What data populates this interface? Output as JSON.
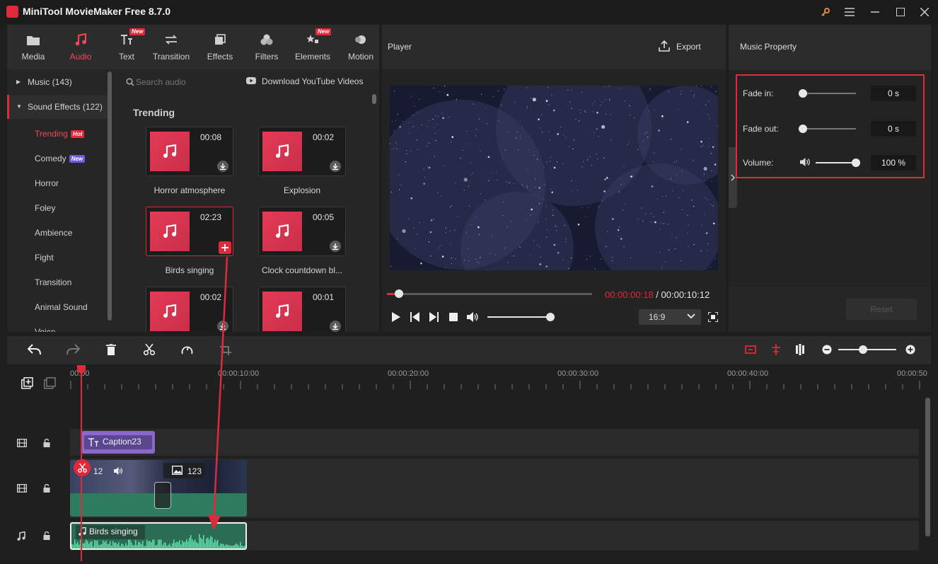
{
  "app": {
    "title": "MiniTool MovieMaker Free 8.7.0"
  },
  "tabs": [
    {
      "label": "Media",
      "icon": "folder-icon",
      "new": false
    },
    {
      "label": "Audio",
      "icon": "music-note-icon",
      "new": false
    },
    {
      "label": "Text",
      "icon": "text-icon",
      "new": true
    },
    {
      "label": "Transition",
      "icon": "transition-icon",
      "new": false
    },
    {
      "label": "Effects",
      "icon": "effects-icon",
      "new": false
    },
    {
      "label": "Filters",
      "icon": "filters-icon",
      "new": false
    },
    {
      "label": "Elements",
      "icon": "elements-icon",
      "new": true
    },
    {
      "label": "Motion",
      "icon": "motion-icon",
      "new": false
    }
  ],
  "new_badge": "New",
  "categories": {
    "music": "Music (143)",
    "sound_effects": "Sound Effects (122)",
    "sub": [
      {
        "label": "Trending",
        "badge": "Hot",
        "active": true
      },
      {
        "label": "Comedy",
        "badge": "New",
        "active": false
      },
      {
        "label": "Horror",
        "badge": "",
        "active": false
      },
      {
        "label": "Foley",
        "badge": "",
        "active": false
      },
      {
        "label": "Ambience",
        "badge": "",
        "active": false
      },
      {
        "label": "Fight",
        "badge": "",
        "active": false
      },
      {
        "label": "Transition",
        "badge": "",
        "active": false
      },
      {
        "label": "Animal Sound",
        "badge": "",
        "active": false
      },
      {
        "label": "Voice",
        "badge": "",
        "active": false
      }
    ]
  },
  "library": {
    "search_placeholder": "Search audio",
    "download_label": "Download YouTube Videos",
    "section_title": "Trending",
    "items": [
      {
        "title": "Horror atmosphere",
        "duration": "00:08"
      },
      {
        "title": "Explosion",
        "duration": "00:02"
      },
      {
        "title": "Birds singing",
        "duration": "02:23"
      },
      {
        "title": "Clock countdown bl...",
        "duration": "00:05"
      },
      {
        "title": "",
        "duration": "00:02"
      },
      {
        "title": "",
        "duration": "00:01"
      }
    ]
  },
  "player": {
    "title": "Player",
    "export_label": "Export",
    "current_time": "00:00:00:18",
    "total_time": " / 00:00:10:12",
    "progress": 0.06,
    "volume": 0.95,
    "aspect": "16:9"
  },
  "property": {
    "title": "Music Property",
    "fade_in_label": "Fade in:",
    "fade_in_value": "0 s",
    "fade_out_label": "Fade out:",
    "fade_out_value": "0 s",
    "volume_label": "Volume:",
    "volume_value": "100 %",
    "reset_label": "Reset"
  },
  "timeline": {
    "ticks": [
      "00:00",
      "00:00:10:00",
      "00:00:20:00",
      "00:00:30:00",
      "00:00:40:00",
      "00:00:50"
    ],
    "caption_clip": "Caption23",
    "video_clip_a": "12",
    "video_clip_b": "123",
    "audio_clip": "Birds singing"
  },
  "colors": {
    "accent": "#e0293a",
    "audio_clip": "#2f7a5c",
    "caption_clip": "#8a67c9",
    "highlight_box": "#e0293a"
  }
}
